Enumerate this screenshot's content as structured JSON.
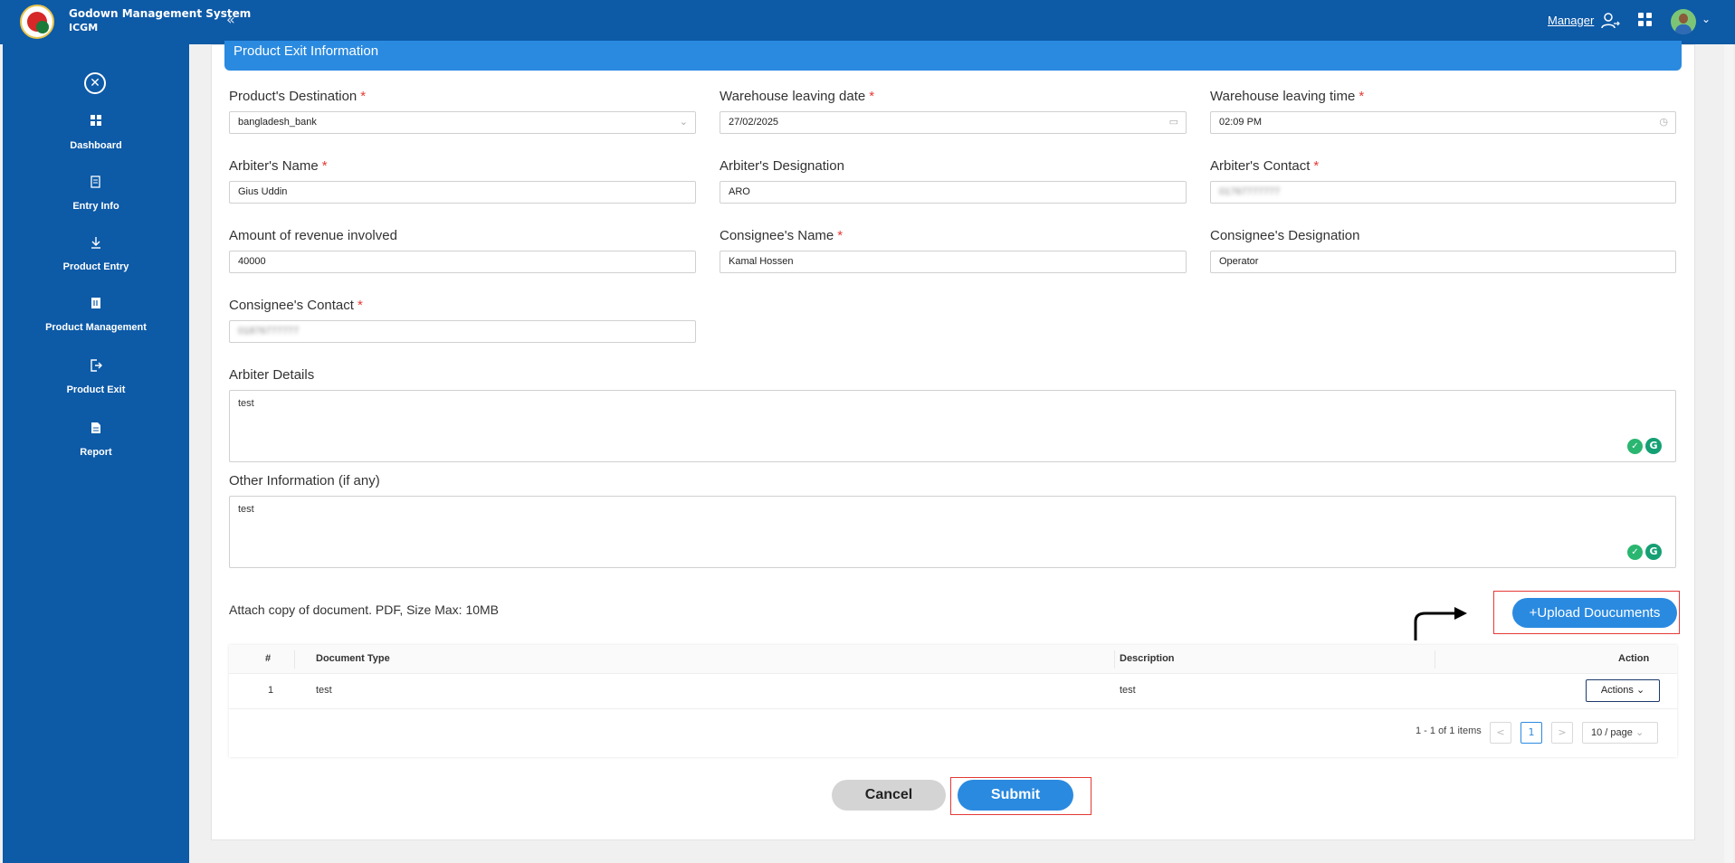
{
  "header": {
    "app_title": "Godown Management System",
    "app_subtitle": "ICGM",
    "role_link": "Manager",
    "icons": [
      "collapse-icon",
      "user-switch-icon",
      "apps-grid-icon",
      "avatar",
      "chevron-down-icon"
    ]
  },
  "sidebar": {
    "items": [
      {
        "label": "Dashboard",
        "icon": "dashboard-icon"
      },
      {
        "label": "Entry Info",
        "icon": "entry-info-icon"
      },
      {
        "label": "Product Entry",
        "icon": "download-icon"
      },
      {
        "label": "Product Management",
        "icon": "management-icon"
      },
      {
        "label": "Product Exit",
        "icon": "exit-icon"
      },
      {
        "label": "Report",
        "icon": "report-icon"
      }
    ]
  },
  "form": {
    "section_title": "Product Exit Information",
    "destination": {
      "label": "Product's Destination",
      "value": "bangladesh_bank"
    },
    "leaving_date": {
      "label": "Warehouse leaving date",
      "value": "27/02/2025"
    },
    "leaving_time": {
      "label": "Warehouse leaving time",
      "value": "02:09 PM"
    },
    "arbiter_name": {
      "label": "Arbiter's Name",
      "value": "Gius Uddin"
    },
    "arbiter_designation": {
      "label": "Arbiter's Designation",
      "value": "ARO"
    },
    "arbiter_contact": {
      "label": "Arbiter's Contact",
      "value": "01767777777"
    },
    "revenue": {
      "label": "Amount of revenue involved",
      "value": "40000"
    },
    "consignee_name": {
      "label": "Consignee's Name",
      "value": "Kamal Hossen"
    },
    "consignee_designation": {
      "label": "Consignee's Designation",
      "value": "Operator"
    },
    "consignee_contact": {
      "label": "Consignee's Contact",
      "value": "01876777777"
    },
    "arbiter_details": {
      "label": "Arbiter Details",
      "value": "test"
    },
    "other_info": {
      "label": "Other Information (if any)",
      "value": "test"
    },
    "required_mark": "*"
  },
  "documents": {
    "attach_label": "Attach copy of document. PDF, Size Max: 10MB",
    "upload_button": "+Upload Doucuments",
    "columns": [
      "#",
      "Document Type",
      "Description",
      "Action"
    ],
    "rows": [
      {
        "index": "1",
        "type": "test",
        "description": "test",
        "action": "Actions"
      }
    ],
    "pagination": {
      "total": "1 - 1 of 1 items",
      "prev": "<",
      "page": "1",
      "next": ">",
      "page_size": "10 / page"
    }
  },
  "buttons": {
    "cancel": "Cancel",
    "submit": "Submit"
  }
}
